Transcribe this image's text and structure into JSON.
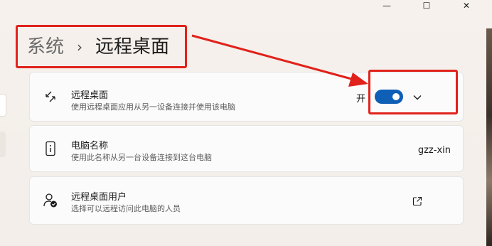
{
  "window": {
    "minimize_glyph": "—",
    "maximize_glyph": "☐",
    "close_glyph": "✕"
  },
  "breadcrumb": {
    "parent": "系统",
    "separator": "›",
    "current": "远程桌面"
  },
  "remote_desktop": {
    "title": "远程桌面",
    "description": "使用远程桌面应用从另一设备连接并使用该电脑",
    "toggle_state_label": "开",
    "toggle_on": true
  },
  "pc_name": {
    "title": "电脑名称",
    "description": "使用此名称从另一台设备连接到这台电脑",
    "value": "gzz-xin"
  },
  "remote_users": {
    "title": "远程桌面用户",
    "description": "选择可以远程访问此电脑的人员"
  },
  "colors": {
    "accent": "#0f5fb6",
    "annotation_red": "#e0221b"
  },
  "icons": {
    "remote_desktop": "remote-desktop-icon",
    "pc_name": "pc-info-icon",
    "users": "user-check-icon",
    "expand": "chevron-down-icon",
    "external": "open-external-icon"
  }
}
